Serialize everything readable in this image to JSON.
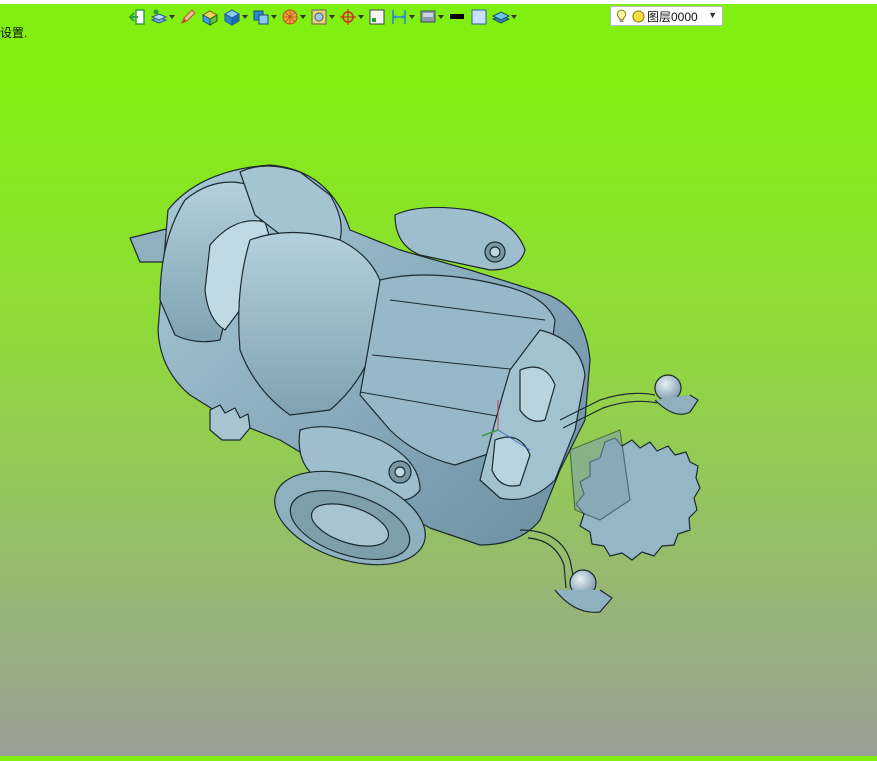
{
  "status": {
    "text": "设置."
  },
  "toolbar": {
    "buttons": [
      {
        "name": "exit-sketch-icon",
        "color": "#2a9a3a"
      },
      {
        "name": "layer-style-icon",
        "color": "#3b7fd0"
      },
      {
        "name": "pen-icon",
        "color": "#d0682a"
      },
      {
        "name": "paint-box-icon",
        "color": "#e0a020"
      },
      {
        "name": "solid-box-icon",
        "color": "#2f86d4"
      },
      {
        "name": "render-mode-icon",
        "color": "#2f86d4"
      },
      {
        "name": "shaded-sphere-icon",
        "color": "#e07a20"
      },
      {
        "name": "texture-icon",
        "color": "#d4b020"
      },
      {
        "name": "snap-point-icon",
        "color": "#d03020"
      },
      {
        "name": "frame-icon",
        "color": "#404040"
      },
      {
        "name": "dimension-icon",
        "color": "#2f86d4"
      },
      {
        "name": "display-icon",
        "color": "#607080"
      },
      {
        "name": "line-color-icon",
        "color": "#000000"
      },
      {
        "name": "fill-color-icon",
        "color": "#b8d4f0"
      },
      {
        "name": "layers-icon",
        "color": "#40a0c0"
      }
    ]
  },
  "layer": {
    "current": "图层0000"
  },
  "model": {
    "name": "wheelchair-3d-model",
    "color": "#8fb4c4",
    "edge_color": "#1c2a30"
  }
}
